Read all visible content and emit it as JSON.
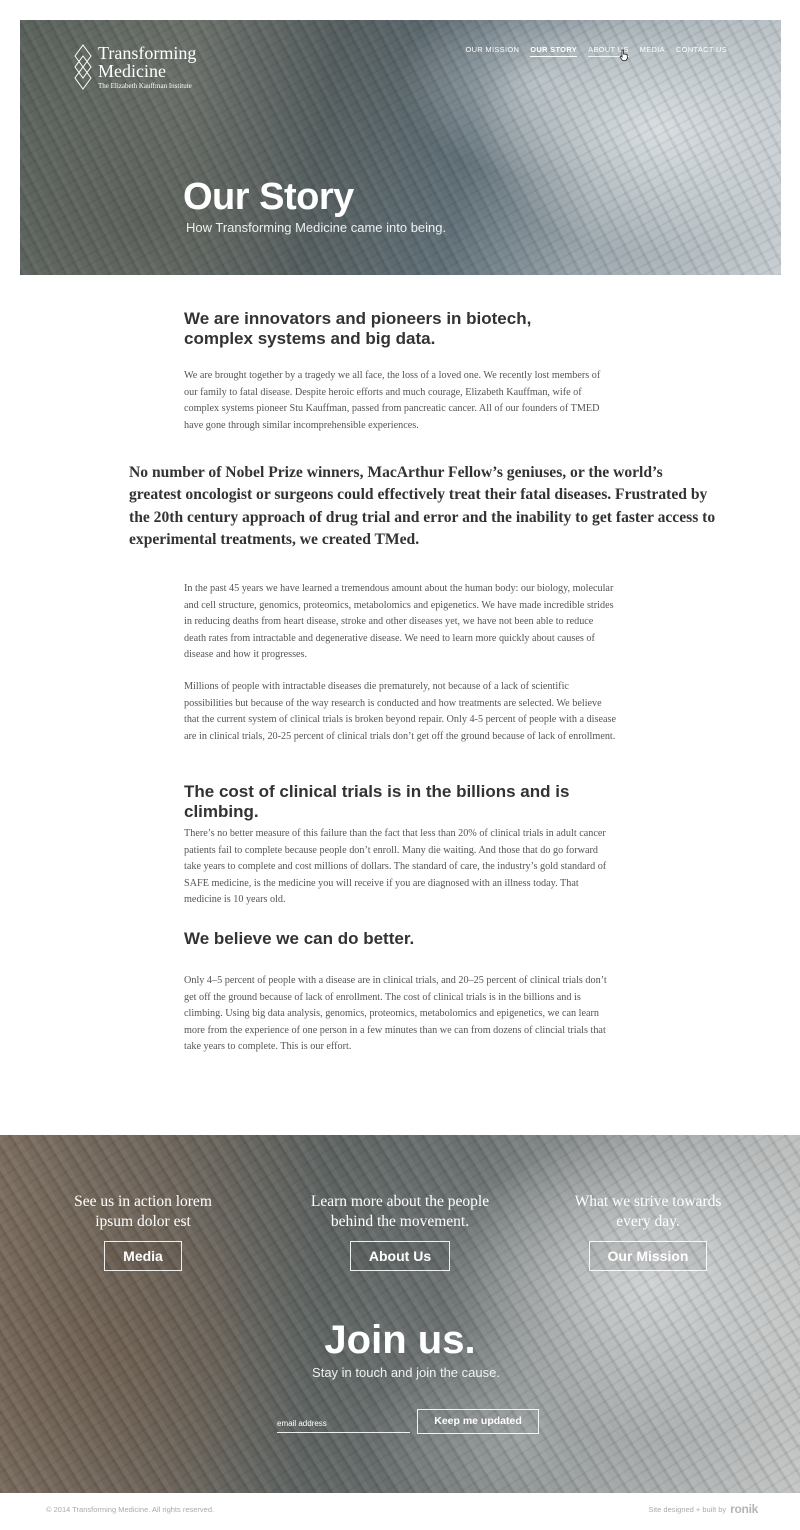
{
  "brand": {
    "name": "Transforming\nMedicine",
    "tagline": "The Elizabeth Kauffman Institute"
  },
  "nav": {
    "items": [
      {
        "label": "Our Mission"
      },
      {
        "label": "Our Story"
      },
      {
        "label": "About Us"
      },
      {
        "label": "Media"
      },
      {
        "label": "Contact Us"
      }
    ]
  },
  "hero": {
    "title": "Our Story",
    "subtitle": "How Transforming Medicine came into being."
  },
  "content": {
    "heading1": "We are innovators and pioneers in biotech, complex systems and big data.",
    "para1": "We are brought together by a tragedy we all face, the loss of a loved one. We recently lost members of our family to fatal disease. Despite heroic efforts and much courage, Elizabeth Kauffman, wife of complex systems pioneer Stu Kauffman, passed from pancreatic cancer. All of our founders of TMED have gone through similar incomprehensible experiences.",
    "quote": "No number of Nobel Prize winners, MacArthur Fellow’s geniuses, or the world’s greatest oncologist or surgeons could effectively treat their fatal diseases. Frustrated by the 20th century approach of drug trial and error and the inability to get faster access to experimental treatments, we created TMed.",
    "para2": "In the past 45 years we have learned a tremendous amount about the human body: our biology, molecular and cell structure, genomics, proteomics, metabolomics and epigenetics. We have made incredible strides in reducing deaths from heart disease, stroke and other diseases yet, we have not been able to reduce death rates from intractable and degenerative disease. We need to learn more quickly about causes of disease and how it progresses.",
    "para3": "Millions of people with intractable diseases die prematurely, not because of a lack of scientific possibilities but because of the way research is conducted and how treatments are selected. We believe that the current system of clinical trials is broken beyond repair. Only 4-5 percent of people with a disease are in clinical trials, 20-25 percent of clinical trials don’t get off the ground because of lack of enrollment.",
    "heading2": "The cost of clinical trials is in the billions and is climbing.",
    "para4": "There’s no better measure of this failure than the fact that less than 20% of clinical trials in adult cancer patients fail to complete because people don’t enroll. Many die waiting. And those that do go forward take years to complete and cost millions of dollars. The standard of care, the industry’s gold standard of SAFE medicine, is the medicine you will receive if you are diagnosed with an illness today. That medicine is 10 years old.",
    "heading3": "We believe we can do better.",
    "para5": "Only 4–5 percent of people with a disease are in clinical trials, and 20–25 percent of clinical trials don’t get off the ground because of lack of enrollment. The cost of clinical trials is in the billions and is climbing. Using big data analysis, genomics, proteomics, metabolomics and epigenetics, we can learn more from the experience of one person in a few minutes than we can from dozens of clincial trials that take years to complete. This is our effort."
  },
  "cta": {
    "columns": [
      {
        "text": "See us in action lorem ipsum dolor est",
        "button": "Media"
      },
      {
        "text": "Learn more about the people behind the movement.",
        "button": "About Us"
      },
      {
        "text": "What we strive towards every day.",
        "button": "Our Mission"
      }
    ]
  },
  "join": {
    "title": "Join us.",
    "subtitle": "Stay in touch and join the cause.",
    "email_placeholder": "email address",
    "button": "Keep me updated"
  },
  "footer": {
    "copyright": "© 2014 Transforming Medicine. All rights reserved.",
    "credit": "Site designed + built by",
    "credit_brand": "ronik"
  }
}
